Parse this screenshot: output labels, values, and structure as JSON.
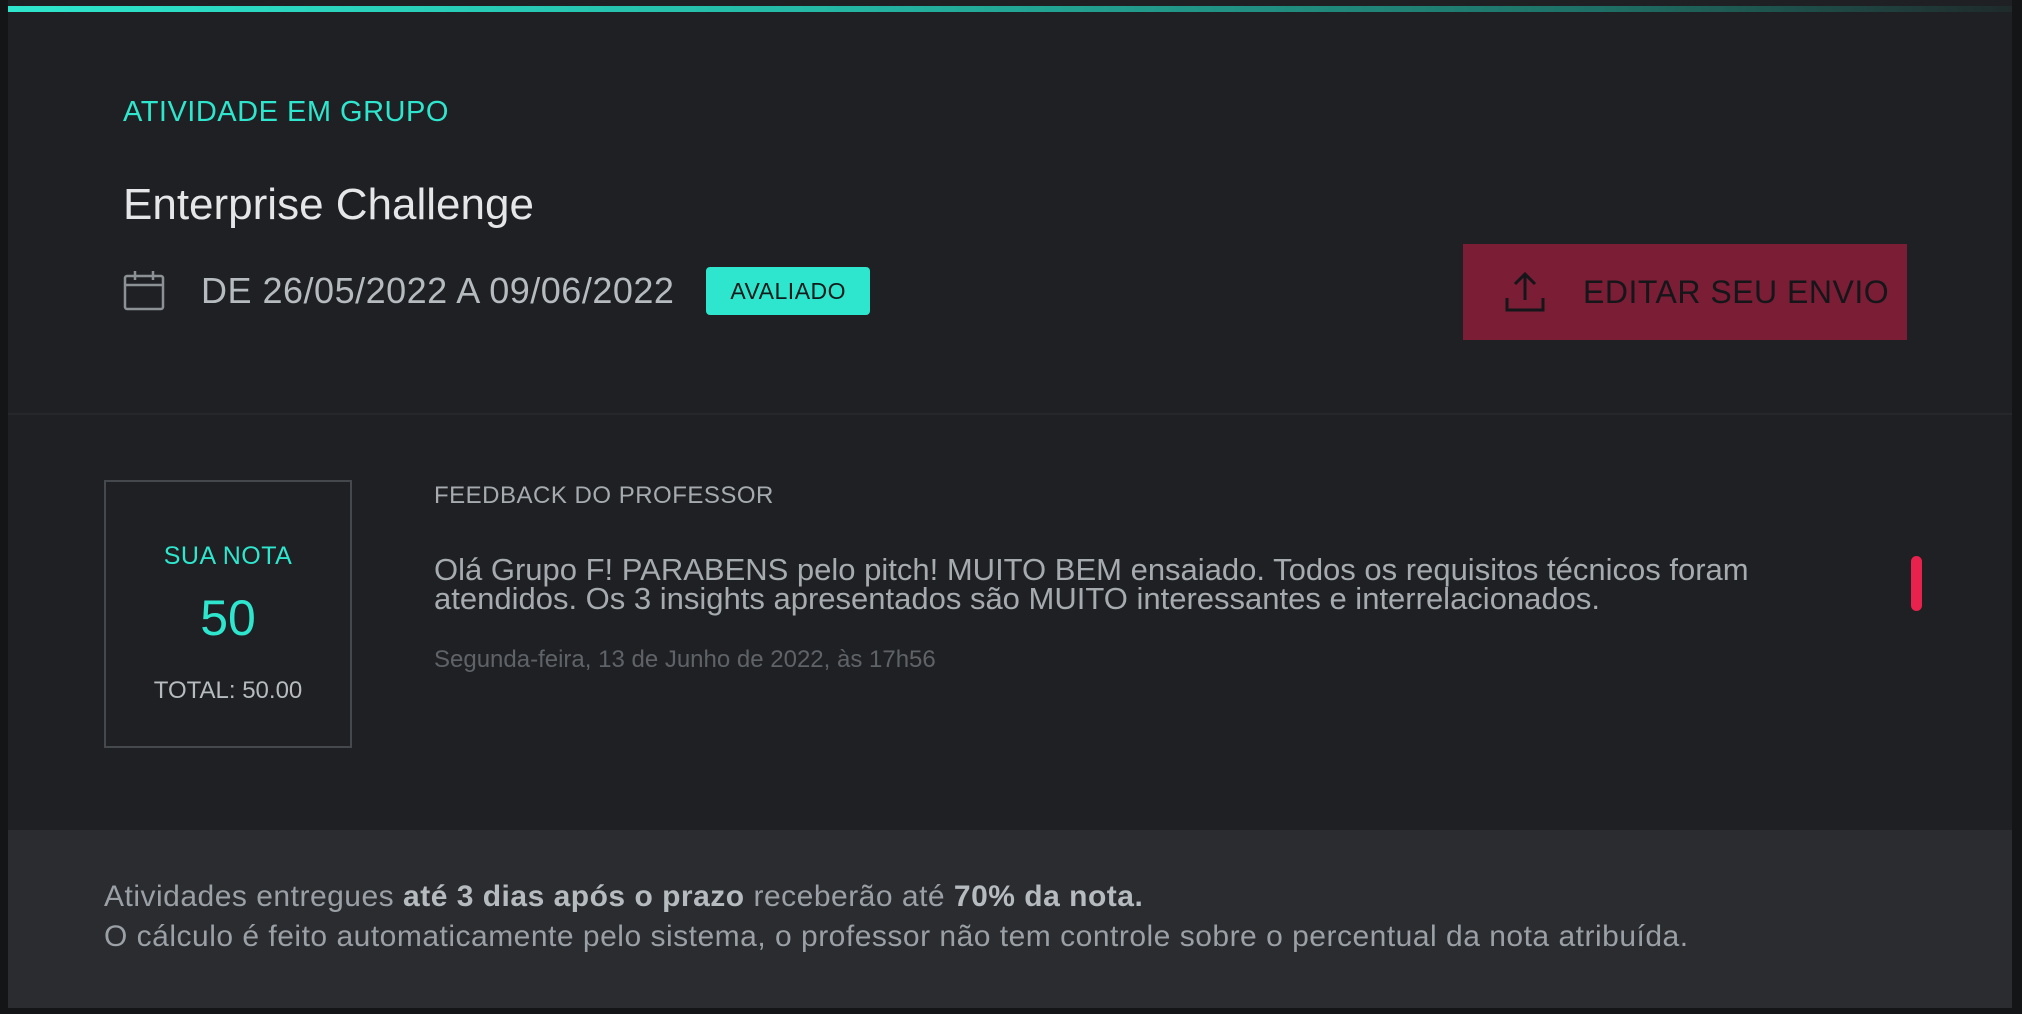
{
  "activity": {
    "kicker": "ATIVIDADE EM GRUPO",
    "title": "Enterprise Challenge",
    "date_range": "DE 26/05/2022 A 09/06/2022",
    "status_badge": "AVALIADO",
    "edit_button_label": "EDITAR SEU ENVIO"
  },
  "grade": {
    "label": "SUA NOTA",
    "value": "50",
    "total": "TOTAL: 50.00"
  },
  "feedback": {
    "title": "FEEDBACK DO PROFESSOR",
    "text": "Olá Grupo F! PARABENS pelo pitch! MUITO BEM ensaiado. Todos os requisitos técnicos foram atendidos. Os 3 insights apresentados são MUITO interessantes e interrelacionados.",
    "date": "Segunda-feira, 13 de Junho de 2022, às 17h56"
  },
  "footer": {
    "line1_pre": "Atividades entregues ",
    "line1_bold1": "até 3 dias após o prazo",
    "line1_mid": " receberão até ",
    "line1_bold2": "70% da nota.",
    "line2": "O cálculo é feito automaticamente pelo sistema, o professor não tem controle sobre o percentual da nota atribuída."
  },
  "icons": {
    "calendar": "calendar-icon",
    "upload": "upload-icon"
  },
  "colors": {
    "accent": "#2ee6cd",
    "edit_button": "#7a1d35",
    "scroll_thumb": "#e8224d",
    "background": "#1f2023"
  }
}
